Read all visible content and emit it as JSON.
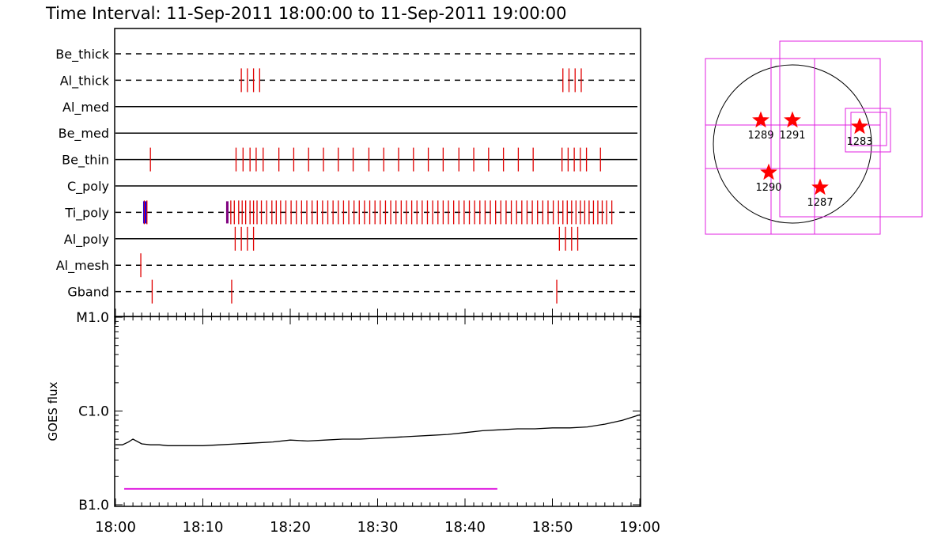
{
  "title": "Time Interval: 11-Sep-2011 18:00:00 to 11-Sep-2011 19:00:00",
  "colors": {
    "tick": "#e00000",
    "blue": "#0000ff",
    "purple": "#7f007f",
    "magenta": "#e020e0",
    "line": "#000000"
  },
  "chart_data": [
    {
      "type": "event-timeline",
      "title": "Time Interval: 11-Sep-2011 18:00:00 to 11-Sep-2011 19:00:00",
      "x_range_minutes": [
        0,
        60
      ],
      "lanes": [
        {
          "label": "Be_thick",
          "style": "dashed",
          "events": []
        },
        {
          "label": "Al_thick",
          "style": "dashed",
          "events": [
            14.4,
            15.1,
            15.8,
            16.5,
            51.2,
            51.9,
            52.6,
            53.3
          ]
        },
        {
          "label": "Al_med",
          "style": "solid",
          "events": []
        },
        {
          "label": "Be_med",
          "style": "solid",
          "events": []
        },
        {
          "label": "Be_thin",
          "style": "solid",
          "events": [
            4.0,
            13.8,
            14.6,
            15.4,
            16.1,
            16.9,
            18.7,
            20.4,
            22.1,
            23.8,
            25.5,
            27.2,
            29.0,
            30.7,
            32.4,
            34.1,
            35.8,
            37.5,
            39.3,
            41.0,
            42.7,
            44.4,
            46.1,
            47.8,
            51.1,
            51.8,
            52.5,
            53.2,
            53.9,
            55.5
          ]
        },
        {
          "label": "C_poly",
          "style": "solid",
          "events": []
        },
        {
          "label": "Ti_poly",
          "style": "dashed",
          "highlights": [
            {
              "x": 3.3,
              "color": "blue"
            },
            {
              "x": 12.8,
              "color": "purple"
            }
          ],
          "events": [
            3.3,
            3.6,
            13.2,
            13.6,
            14.1,
            14.5,
            14.9,
            15.4,
            15.8,
            16.2,
            16.7,
            17.3,
            17.9,
            18.4,
            18.9,
            19.5,
            20.1,
            20.7,
            21.3,
            21.9,
            22.5,
            23.1,
            23.7,
            24.3,
            24.9,
            25.5,
            26.1,
            26.7,
            27.3,
            27.9,
            28.5,
            29.1,
            29.7,
            30.3,
            30.9,
            31.5,
            32.1,
            32.7,
            33.3,
            33.9,
            34.5,
            35.1,
            35.7,
            36.3,
            36.9,
            37.5,
            38.1,
            38.7,
            39.3,
            39.9,
            40.5,
            41.1,
            41.7,
            42.3,
            42.9,
            43.5,
            44.1,
            44.7,
            45.3,
            45.9,
            46.5,
            47.1,
            47.7,
            48.3,
            48.9,
            49.5,
            50.1,
            50.7,
            51.2,
            51.7,
            52.2,
            52.7,
            53.2,
            53.7,
            54.2,
            54.7,
            55.2,
            55.7,
            56.2,
            56.8
          ]
        },
        {
          "label": "Al_poly",
          "style": "solid",
          "events": [
            13.7,
            14.4,
            15.1,
            15.8,
            50.8,
            51.5,
            52.2,
            52.9
          ]
        },
        {
          "label": "Al_mesh",
          "style": "dashed",
          "events": [
            2.9
          ]
        },
        {
          "label": "Gband",
          "style": "dashed",
          "events": [
            4.2,
            13.3,
            50.5
          ]
        }
      ]
    },
    {
      "type": "line",
      "ylabel": "GOES flux",
      "x_tick_labels": [
        "18:00",
        "18:10",
        "18:20",
        "18:30",
        "18:40",
        "18:50",
        "19:00"
      ],
      "x_ticks_minutes": [
        0,
        10,
        20,
        30,
        40,
        50,
        60
      ],
      "y_tick_labels": [
        "B1.0",
        "C1.0",
        "M1.0"
      ],
      "y_scale": "log",
      "y_range_log10": [
        -7,
        -5
      ],
      "series": [
        {
          "x": [
            0,
            0.8,
            1.5,
            2.0,
            3.0,
            4,
            5,
            6,
            7,
            8,
            9,
            10,
            12,
            14,
            16,
            18,
            20,
            22,
            24,
            26,
            28,
            30,
            32,
            34,
            36,
            38,
            40,
            42,
            44,
            46,
            48,
            50,
            52,
            54,
            56,
            58,
            60
          ],
          "log10_flux": [
            -6.36,
            -6.36,
            -6.33,
            -6.3,
            -6.35,
            -6.36,
            -6.36,
            -6.37,
            -6.37,
            -6.37,
            -6.37,
            -6.37,
            -6.36,
            -6.35,
            -6.34,
            -6.33,
            -6.31,
            -6.32,
            -6.31,
            -6.3,
            -6.3,
            -6.29,
            -6.28,
            -6.27,
            -6.26,
            -6.25,
            -6.23,
            -6.21,
            -6.2,
            -6.19,
            -6.19,
            -6.18,
            -6.18,
            -6.17,
            -6.14,
            -6.1,
            -6.04
          ]
        }
      ],
      "markers": [
        {
          "x_start": 1,
          "x_end": 43.7,
          "log10_flux": -6.83,
          "color": "magenta"
        }
      ]
    },
    {
      "type": "disk-map",
      "regions": [
        {
          "label": "1289",
          "pos": [
            -0.4,
            0.3
          ]
        },
        {
          "label": "1291",
          "pos": [
            0.0,
            0.3
          ]
        },
        {
          "label": "1283",
          "pos": [
            0.85,
            0.22
          ]
        },
        {
          "label": "1290",
          "pos": [
            -0.3,
            -0.36
          ]
        },
        {
          "label": "1287",
          "pos": [
            0.35,
            -0.55
          ]
        }
      ]
    }
  ]
}
